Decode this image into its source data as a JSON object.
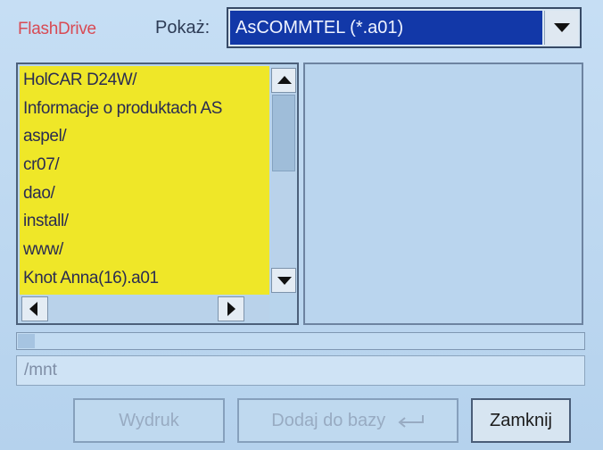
{
  "app": {
    "brand": "FlashDrive"
  },
  "filter": {
    "label": "Pokaż:",
    "selected": "AsCOMMTEL (*.a01)"
  },
  "file_list": {
    "items": [
      "HolCAR D24W/",
      "Informacje o produktach AS",
      "aspel/",
      "cr07/",
      "dao/",
      "install/",
      "www/",
      "Knot Anna(16).a01"
    ]
  },
  "path": {
    "value": "/mnt"
  },
  "buttons": {
    "print": "Wydruk",
    "add_to_db": "Dodaj do bazy",
    "close": "Zamknij"
  },
  "progress": {
    "fraction": 0.03
  },
  "colors": {
    "list_background": "#efe728",
    "selected_background": "#1238a8",
    "brand": "#d84a54",
    "screen_background": "#b7d4ee"
  },
  "icons": {
    "dropdown": "chevron-down-icon",
    "scroll_up": "arrow-up-icon",
    "scroll_down": "arrow-down-icon",
    "scroll_left": "arrow-left-icon",
    "scroll_right": "arrow-right-icon",
    "enter": "enter-key-icon"
  }
}
